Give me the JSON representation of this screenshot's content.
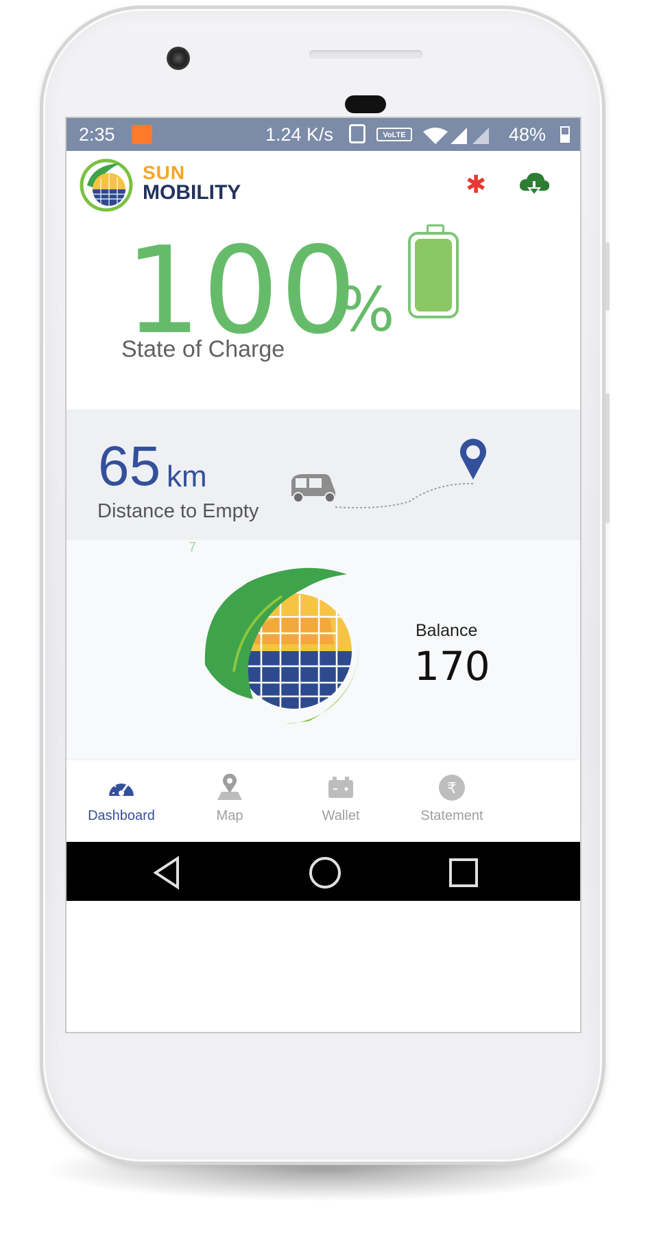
{
  "status_bar": {
    "time": "2:35",
    "network_speed": "1.24 K/s",
    "volte": "VoLTE",
    "battery_percent": "48%"
  },
  "app": {
    "logo_line1": "SUN",
    "logo_line2": "MOBILITY",
    "brand_colors": {
      "sun": "#f5a623",
      "mobility": "#22335c",
      "green": "#66bb6a",
      "blue": "#34509a"
    }
  },
  "header_icons": {
    "bluetooth": "bluetooth-icon",
    "sync": "cloud-download-icon"
  },
  "state_of_charge": {
    "value": "100",
    "unit": "%",
    "label": "State of Charge",
    "fill_fraction": 1.0
  },
  "distance_to_empty": {
    "value": "65",
    "unit": "km",
    "label": "Distance to Empty"
  },
  "balance": {
    "label": "Balance",
    "value": "170",
    "mark": "7"
  },
  "bottom_nav": {
    "items": [
      {
        "label": "Dashboard",
        "icon": "speedometer-icon",
        "active": true
      },
      {
        "label": "Map",
        "icon": "map-pin-icon",
        "active": false
      },
      {
        "label": "Wallet",
        "icon": "battery-wallet-icon",
        "active": false
      },
      {
        "label": "Statement",
        "icon": "rupee-icon",
        "active": false
      }
    ]
  }
}
